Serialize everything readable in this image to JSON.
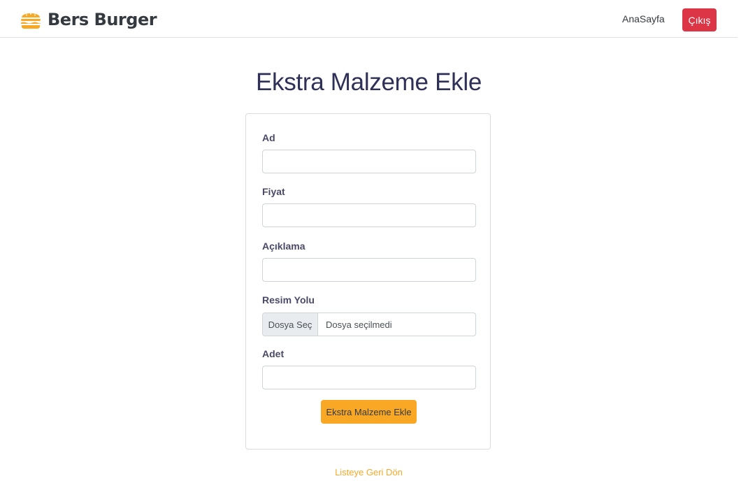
{
  "navbar": {
    "brand_name": "Bers Burger",
    "brand_icon": "burger-icon",
    "home_link": "AnaSayfa",
    "logout_label": "Çıkış"
  },
  "page": {
    "title": "Ekstra Malzeme Ekle"
  },
  "form": {
    "name": {
      "label": "Ad",
      "value": ""
    },
    "price": {
      "label": "Fiyat",
      "value": ""
    },
    "description": {
      "label": "Açıklama",
      "value": ""
    },
    "image": {
      "label": "Resim Yolu",
      "button_label": "Dosya Seç",
      "status": "Dosya seçilmedi"
    },
    "quantity": {
      "label": "Adet",
      "value": ""
    },
    "submit_label": "Ekstra Malzeme Ekle"
  },
  "back_link": "Listeye Geri Dön",
  "colors": {
    "accent": "#f9a826",
    "danger": "#dc3545",
    "title": "#2f3057"
  }
}
